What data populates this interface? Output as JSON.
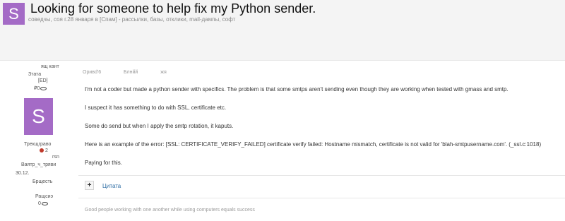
{
  "header": {
    "avatar_letter": "S",
    "title": "Looking for someone to help fix my Python sender.",
    "meta": "соведчы, соя г.28 января в [Спам] - рассылки, базы, отклики, mail-дампы, софт"
  },
  "user_panel": {
    "lines_top": [
      "ящ кант",
      "Зтата",
      "[ED]",
      "₽0"
    ],
    "avatar_letter": "S",
    "lines_bottom": [
      "Трекщграво",
      "2",
      "гsn",
      "Ваятр_ч_тряви",
      "30.12.",
      "Брщесть",
      "Ращсиэ",
      "0"
    ]
  },
  "post": {
    "meta": [
      "Оривd'6",
      "Блнйй",
      "жя"
    ],
    "paragraphs": [
      "I'm not a coder but made a python sender with specifics. The problem is that some smtps aren't sending even though they are working when tested with gmass and smtp.",
      "I suspect it has something to do with SSL, certificate etc.",
      "Some do send but when I apply the smtp rotation, it kaputs.",
      "Here is an example of the error:  [SSL: CERTIFICATE_VERIFY_FAILED] certificate verify failed: Hostname mismatch, certificate is not valid for 'blah-smtpusername.com'. (_ssl.c:1018)",
      "Paying for this."
    ],
    "quote_button": "+",
    "quote_label": "Цитата",
    "signature": "Good people working with one another while using computers equals success"
  },
  "colors": {
    "accent": "#a46bc6",
    "link": "#2e6da4",
    "header_bg": "#f4f4f4"
  }
}
